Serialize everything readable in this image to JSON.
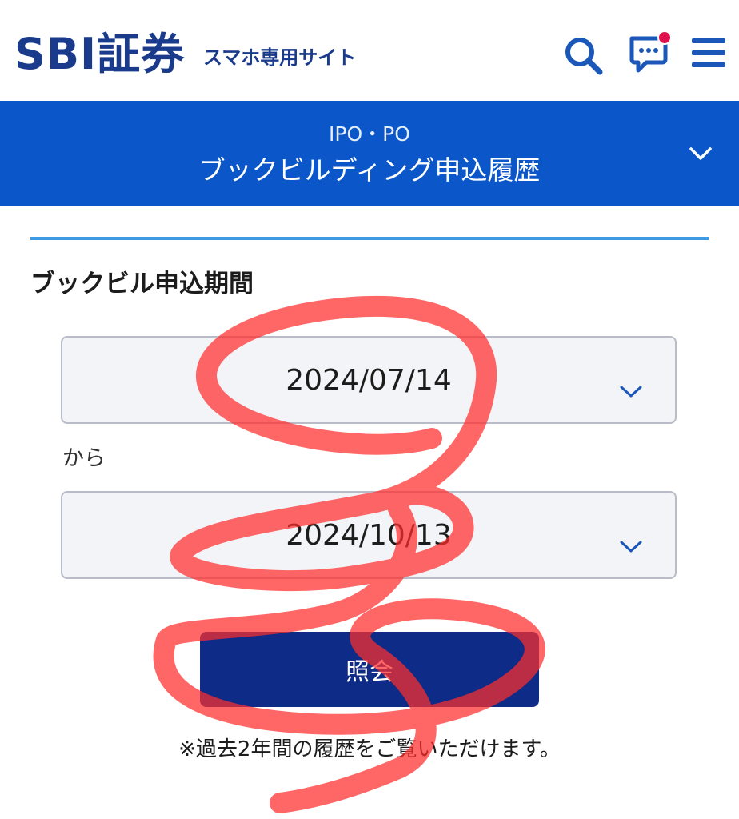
{
  "header": {
    "logo_text": "SBI証券",
    "site_label": "スマホ専用サイト",
    "icons": {
      "search": "search-icon",
      "notifications": "chat-bubble-icon",
      "menu": "hamburger-menu-icon"
    },
    "notification_dot_color": "#e0114f"
  },
  "section": {
    "subtitle": "IPO・PO",
    "title": "ブックビルディング申込履歴",
    "chevron_icon": "chevron-down-icon"
  },
  "form": {
    "period_heading": "ブックビル申込期間",
    "from_date": "2024/07/14",
    "from_label": "から",
    "to_date": "2024/10/13",
    "submit_label": "照会",
    "note": "※過去2年間の履歴をご覧いただけます。"
  },
  "colors": {
    "brand_navy": "#1a3a8c",
    "section_blue": "#0b56c8",
    "divider_blue": "#3d9be6",
    "button_navy": "#0e2b87",
    "annotation_red": "#ff2d2d"
  }
}
